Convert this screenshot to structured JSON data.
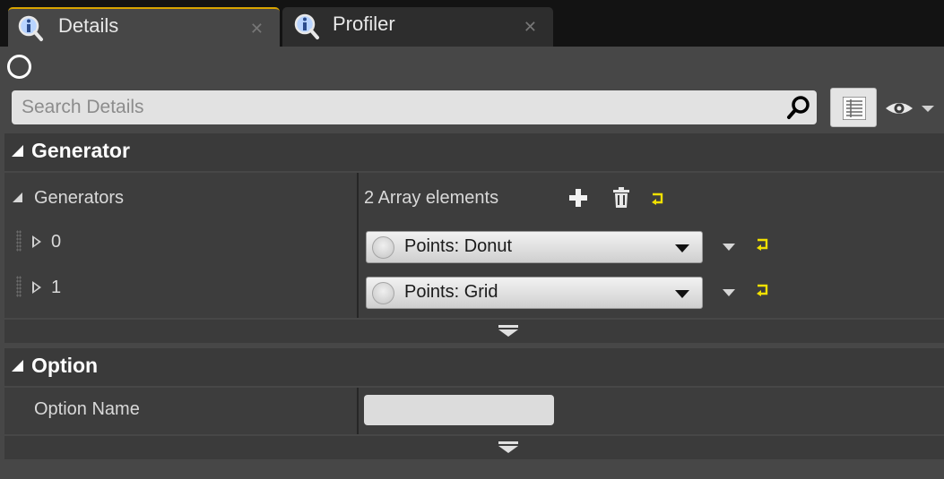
{
  "tabs": [
    {
      "label": "Details",
      "active": true,
      "icon": "info-magnifier-icon"
    },
    {
      "label": "Profiler",
      "active": false,
      "icon": "info-magnifier-icon"
    }
  ],
  "search": {
    "placeholder": "Search Details",
    "value": ""
  },
  "categories": {
    "generator": {
      "title": "Generator",
      "generators_label": "Generators",
      "array_summary": "2 Array elements",
      "elements": [
        {
          "index": "0",
          "value": "Points: Donut"
        },
        {
          "index": "1",
          "value": "Points: Grid"
        }
      ]
    },
    "option": {
      "title": "Option",
      "option_name_label": "Option Name",
      "option_name_value": ""
    }
  },
  "colors": {
    "accent_tab": "#d9a400",
    "reset_arrow": "#f0e000",
    "panel_bg": "#474747"
  }
}
